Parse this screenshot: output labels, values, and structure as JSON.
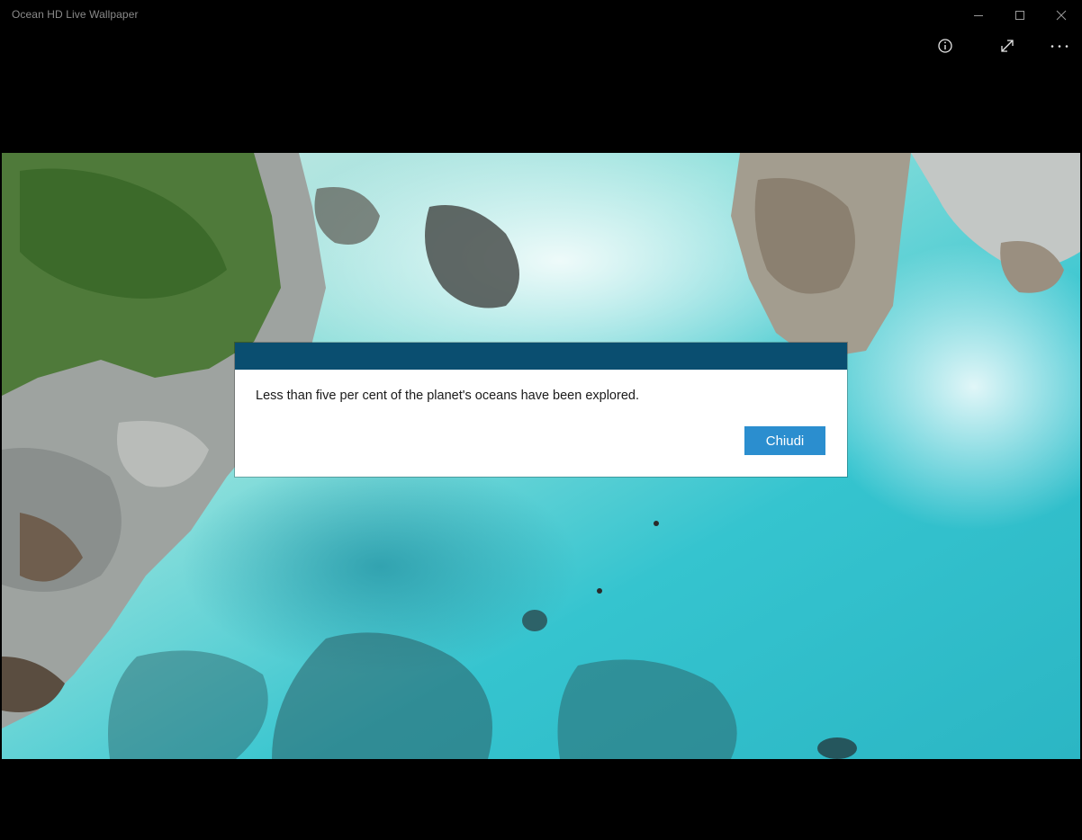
{
  "window": {
    "title": "Ocean HD Live Wallpaper",
    "controls": {
      "minimize_icon": "minimize-icon",
      "maximize_icon": "maximize-icon",
      "close_icon": "close-icon"
    }
  },
  "appbar": {
    "info_icon": "info-icon",
    "expand_icon": "expand-icon",
    "more_icon": "more-icon"
  },
  "dialog": {
    "message": "Less than five per cent of the planet's oceans have been explored.",
    "close_label": "Chiudi"
  },
  "colors": {
    "background": "#000000",
    "dialog_header": "#0a4e70",
    "dialog_button": "#2b8ecf",
    "water": "#3fc6cf"
  }
}
